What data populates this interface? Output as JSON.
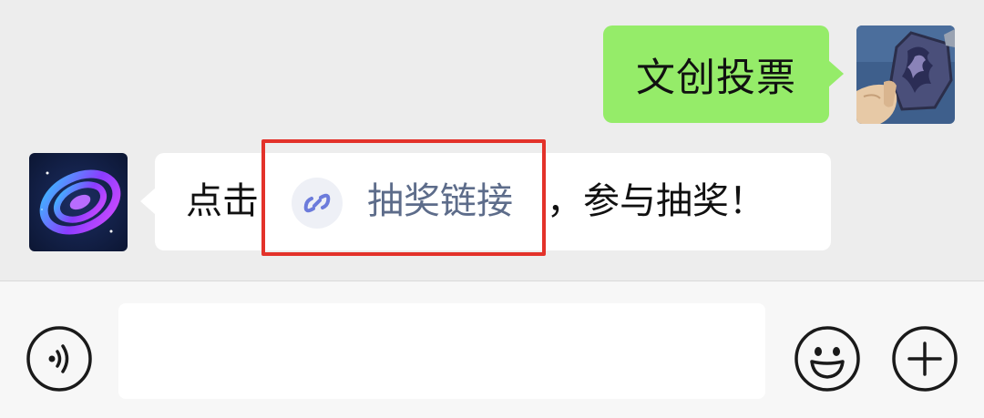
{
  "chat": {
    "messages": [
      {
        "direction": "outgoing",
        "text": "文创投票",
        "avatar": "dragon-seal-avatar-icon"
      },
      {
        "direction": "incoming",
        "avatar": "galaxy-avatar-icon",
        "text_before": "点击",
        "link_icon": "mini-program-link-icon",
        "link_text": "抽奖链接",
        "text_after": "，参与抽奖！"
      }
    ]
  },
  "highlight": {
    "color": "#e3322a"
  },
  "input_bar": {
    "voice_icon": "voice-icon",
    "emoji_icon": "emoji-icon",
    "add_icon": "add-icon"
  },
  "colors": {
    "background": "#ededed",
    "outgoing_bubble": "#95ec69",
    "incoming_bubble": "#ffffff",
    "link_text": "#5d6c8a"
  }
}
